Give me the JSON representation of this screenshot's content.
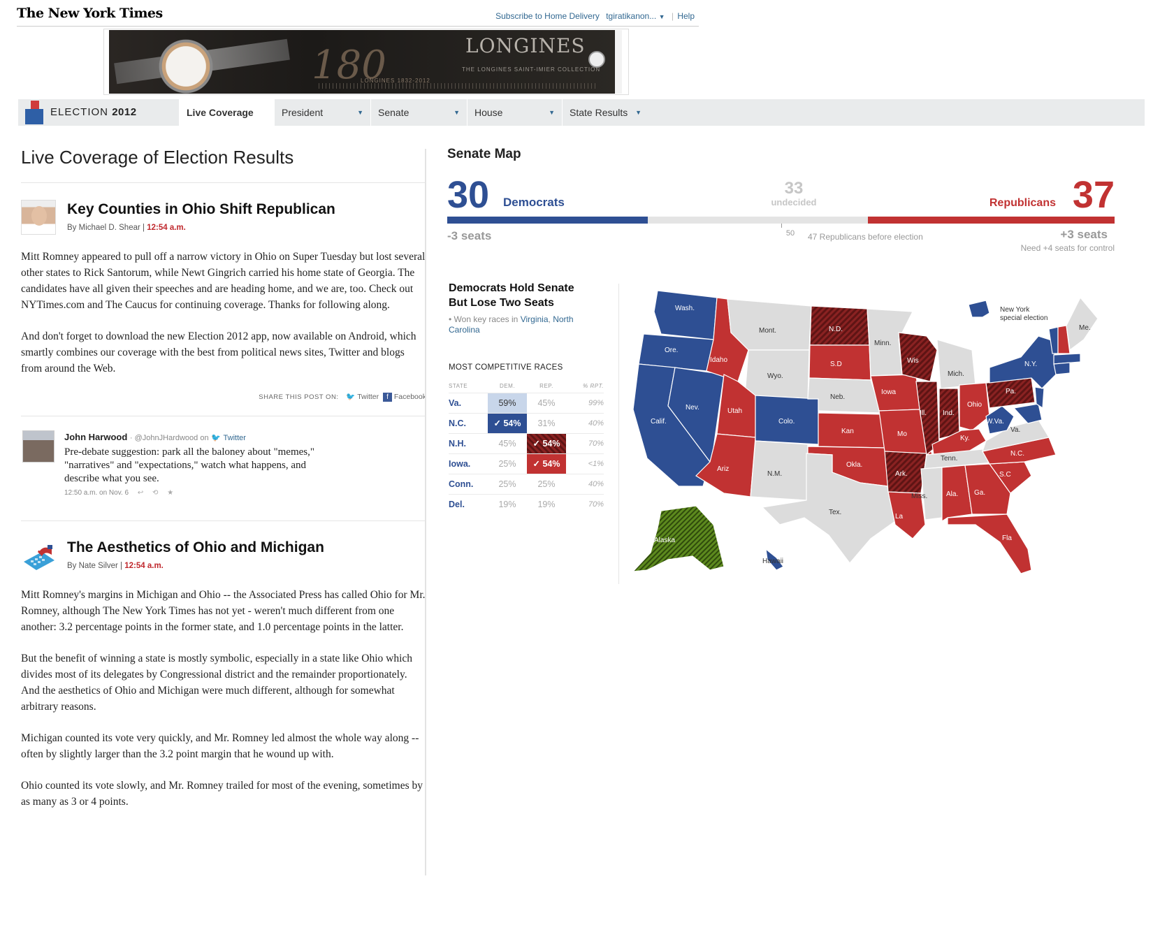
{
  "masthead": {
    "logo": "The New York Times",
    "subscribe": "Subscribe to Home Delivery",
    "user": "tgiratikanon...",
    "help": "Help"
  },
  "ad": {
    "number": "180",
    "years": "LONGINES 1832-2012",
    "brand": "LONGINES",
    "collection": "THE LONGINES SAINT-IMIER COLLECTION"
  },
  "election_nav": {
    "title_prefix": "ELECTION",
    "title_year": "2012",
    "items": [
      {
        "label": "Live Coverage",
        "active": true
      },
      {
        "label": "President"
      },
      {
        "label": "Senate"
      },
      {
        "label": "House"
      },
      {
        "label": "State Results"
      }
    ]
  },
  "left": {
    "page_title": "Live Coverage of Election Results",
    "post1": {
      "title": "Key Counties in Ohio Shift Republican",
      "author": "By Michael D. Shear |",
      "time": "12:54 a.m.",
      "p1": "Mitt Romney appeared to pull off a narrow victory in Ohio on Super Tuesday but lost several other states to Rick Santorum, while Newt Gingrich carried his home state of Georgia. The candidates have all given their speeches and are heading home, and we are, too. Check out NYTimes.com and The Caucus for continuing coverage. Thanks for following along.",
      "p2": "And don't forget to download the new Election 2012 app, now available on Android, which smartly combines our coverage with the best from political news sites, Twitter and blogs from around the Web."
    },
    "share": {
      "label": "SHARE THIS POST ON:",
      "twitter": "Twitter",
      "facebook": "Facebook"
    },
    "tweet": {
      "name": "John Harwood",
      "handle": "· @JohnJHardwood on",
      "service": "Twitter",
      "text": "Pre-debate suggestion: park all the baloney about \"memes,\" \"narratives\" and \"expectations,\" watch what happens, and describe what you see.",
      "time": "12:50 a.m. on Nov. 6"
    },
    "post2": {
      "title": "The Aesthetics of Ohio and Michigan",
      "author": "By Nate Silver |",
      "time": "12:54 a.m.",
      "p1": "Mitt Romney's margins in Michigan and Ohio -- the Associated Press has called Ohio for Mr. Romney, although The New York Times has not yet - weren't much different from one another: 3.2 percentage points in the former state, and 1.0 percentage points in the latter.",
      "p2": "But the benefit of winning a state is mostly symbolic, especially in a state like Ohio which divides most of its delegates by Congressional district and the remainder propor­tionately. And the aesthetics of Ohio and Michigan were much different, although for somewhat arbitrary reasons.",
      "p3": "Michigan counted its vote very quickly, and Mr. Romney led almost the whole way along -- often by slightly larger than the 3.2 point margin that he wound up with.",
      "p4": "Ohio counted its vote slowly, and Mr. Romney trailed for most of the evening, some­times by as many as 3 or 4 points."
    }
  },
  "senate": {
    "title": "Senate Map",
    "dem_seats": "30",
    "dem_label": "Democrats",
    "undecided_seats": "33",
    "undecided_label": "undecided",
    "rep_seats": "37",
    "rep_label": "Republicans",
    "dem_change": "-3 seats",
    "midpoint": "50",
    "rep_before": "47 Republicans before election",
    "rep_change": "+3 seats",
    "need": "Need +4 seats for control",
    "bar_counts": {
      "dem": 30,
      "undecided": 33,
      "rep": 37,
      "total": 100
    },
    "headline_1": "Democrats Hold Senate",
    "headline_2": "But Lose Two Seats",
    "note_prefix": "• Won key races in",
    "note_link_1": "Virginia",
    "note_link_2": "North Carolina",
    "races_heading": "MOST COMPETITIVE RACES",
    "races_columns": [
      "STATE",
      "DEM.",
      "REP.",
      "% RPT."
    ],
    "races": [
      {
        "state": "Va.",
        "dem": "59%",
        "rep": "45%",
        "rpt": "99%",
        "dem_style": "demlead",
        "rep_style": ""
      },
      {
        "state": "N.C.",
        "dem": "✓ 54%",
        "rep": "31%",
        "rpt": "40%",
        "dem_style": "demwin",
        "rep_style": ""
      },
      {
        "state": "N.H.",
        "dem": "45%",
        "rep": "✓ 54%",
        "rpt": "70%",
        "dem_style": "",
        "rep_style": "replead"
      },
      {
        "state": "Iowa.",
        "dem": "25%",
        "rep": "✓ 54%",
        "rpt": "<1%",
        "dem_style": "",
        "rep_style": "repwin"
      },
      {
        "state": "Conn.",
        "dem": "25%",
        "rep": "25%",
        "rpt": "40%",
        "dem_style": "",
        "rep_style": ""
      },
      {
        "state": "Del.",
        "dem": "19%",
        "rep": "19%",
        "rpt": "70%",
        "dem_style": "",
        "rep_style": ""
      }
    ],
    "colors": {
      "dem": "#2e4f93",
      "rep": "#c13232",
      "rep_dark": "#7a1c1c",
      "none": "#dcdcdc",
      "other": "#4f7a1a"
    },
    "map_labels": {
      "wash": "Wash.",
      "ore": "Ore.",
      "calif": "Calif.",
      "nev": "Nev.",
      "idaho": "Idaho",
      "mont": "Mont.",
      "wyo": "Wyo.",
      "utah": "Utah",
      "ariz": "Ariz",
      "colo": "Colo.",
      "nm": "N.M.",
      "nd": "N.D.",
      "sd": "S.D",
      "neb": "Neb.",
      "kan": "Kan",
      "okla": "Okla.",
      "tex": "Tex.",
      "minn": "Minn.",
      "iowa": "Iowa",
      "mo": "Mo",
      "ark": "Ark.",
      "la": "La",
      "wis": "Wis",
      "ill": "Ill.",
      "mich": "Mich.",
      "ind": "Ind.",
      "ohio": "Ohio",
      "ky": "Ky.",
      "tenn": "Tenn.",
      "miss": "Miss.",
      "ala": "Ala.",
      "ga": "Ga.",
      "fla": "Fla",
      "sc": "S.C",
      "nc": "N.C.",
      "va": "Va.",
      "wva": "W.Va.",
      "pa": "Pa.",
      "ny": "N.Y.",
      "me": "Me.",
      "alaska": "Alaska",
      "hawaii": "Hawaii",
      "ny_special_1": "New York",
      "ny_special_2": "special election"
    }
  }
}
